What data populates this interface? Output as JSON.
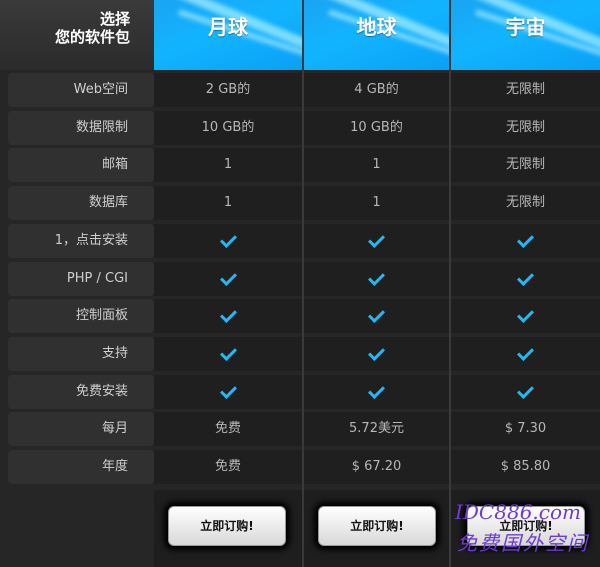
{
  "header": {
    "corner_line1": "选择",
    "corner_line2": "您的软件包",
    "plans": [
      "月球",
      "地球",
      "宇宙"
    ]
  },
  "rows": [
    {
      "label": "Web空间",
      "values": [
        "2 GB的",
        "4 GB的",
        "无限制"
      ]
    },
    {
      "label": "数据限制",
      "values": [
        "10 GB的",
        "10 GB的",
        "无限制"
      ]
    },
    {
      "label": "邮箱",
      "values": [
        "1",
        "1",
        "无限制"
      ]
    },
    {
      "label": "数据库",
      "values": [
        "1",
        "1",
        "无限制"
      ]
    },
    {
      "label": "1，点击安装",
      "values": [
        "check",
        "check",
        "check"
      ]
    },
    {
      "label": "PHP / CGI",
      "values": [
        "check",
        "check",
        "check"
      ]
    },
    {
      "label": "控制面板",
      "values": [
        "check",
        "check",
        "check"
      ]
    },
    {
      "label": "支持",
      "values": [
        "check",
        "check",
        "check"
      ]
    },
    {
      "label": "免费安装",
      "values": [
        "check",
        "check",
        "check"
      ]
    },
    {
      "label": "每月",
      "values": [
        "免费",
        "5.72美元",
        "$ 7.30"
      ]
    },
    {
      "label": "年度",
      "values": [
        "免费",
        "$ 67.20",
        "$ 85.80"
      ]
    }
  ],
  "buttons": {
    "buy_label": "立即订购!"
  },
  "watermark": {
    "line1": "IDC886.com",
    "line2": "免费国外空间"
  },
  "colors": {
    "accent": "#12b4ff",
    "check": "#27b7f0",
    "watermark": "#6f3bd6"
  }
}
